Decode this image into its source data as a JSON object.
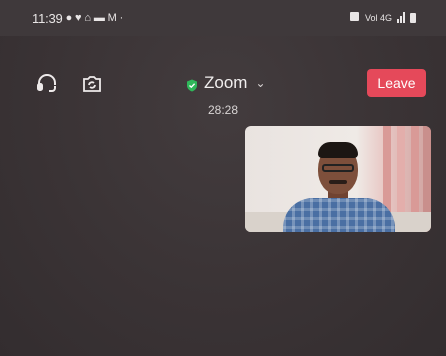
{
  "status_bar": {
    "time": "11:39",
    "left_icons": [
      "messenger-icon",
      "heart-icon",
      "home-icon",
      "card-icon",
      "gmail-icon",
      "dot-icon"
    ],
    "right_icons": [
      "alarm-icon",
      "volte-icon",
      "4g-icon",
      "signal-icon",
      "battery-icon"
    ],
    "network_label": "Vol 4G"
  },
  "toolbar": {
    "meeting_title": "Zoom",
    "timer": "28:28",
    "leave_label": "Leave",
    "leave_color": "#e5495a",
    "shield_color": "#2fb85a"
  },
  "video": {
    "label": "self-view"
  }
}
